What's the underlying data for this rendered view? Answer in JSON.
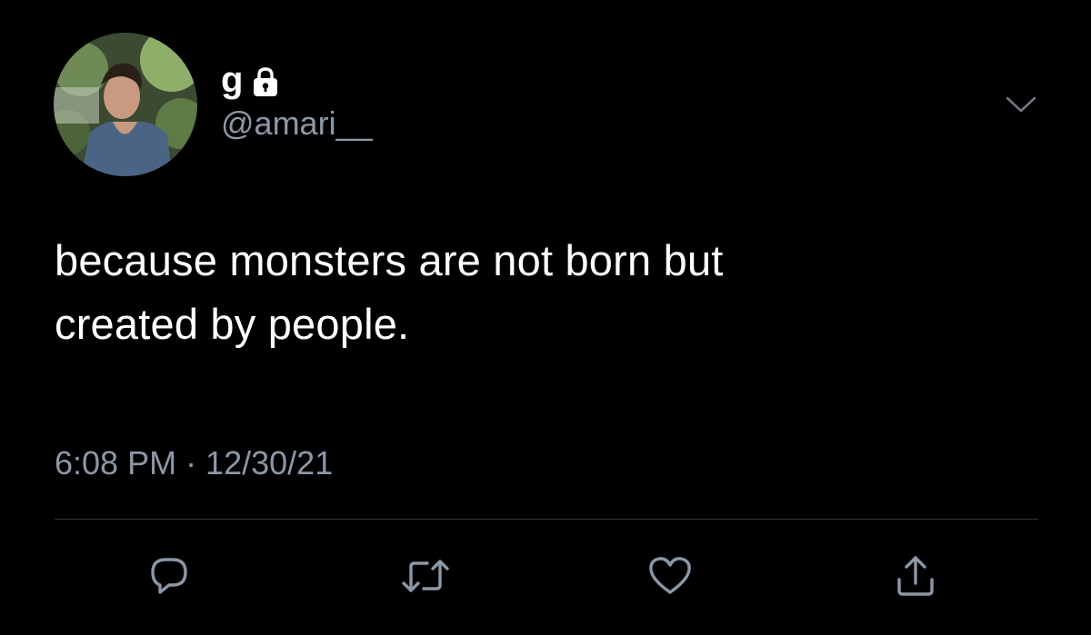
{
  "tweet": {
    "display_name": "g",
    "handle": "@amari__",
    "text_lines": [
      "because monsters are not born but",
      "created by people."
    ],
    "timestamp": "6:08 PM · 12/30/21"
  },
  "icons": {
    "lock": "lock-icon",
    "chevron": "chevron-down-icon",
    "reply": "reply-icon",
    "retweet": "retweet-icon",
    "like": "heart-icon",
    "share": "share-icon"
  },
  "colors": {
    "background": "#000000",
    "text": "#ffffff",
    "secondary": "#8b98a5",
    "divider": "#2f3336"
  }
}
